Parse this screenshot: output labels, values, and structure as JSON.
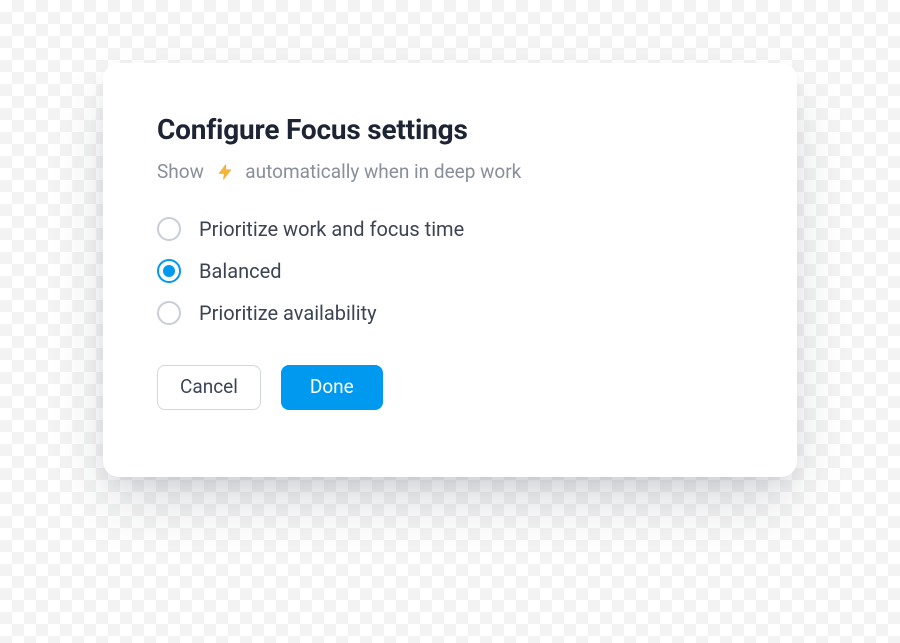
{
  "modal": {
    "title": "Configure Focus settings",
    "subtitle_pre": "Show ",
    "subtitle_post": " automatically when in deep work",
    "icon_name": "lightning-icon",
    "options": [
      {
        "label": "Prioritize work and focus time",
        "selected": false
      },
      {
        "label": "Balanced",
        "selected": true
      },
      {
        "label": "Prioritize availability",
        "selected": false
      }
    ],
    "actions": {
      "cancel": "Cancel",
      "done": "Done"
    }
  }
}
